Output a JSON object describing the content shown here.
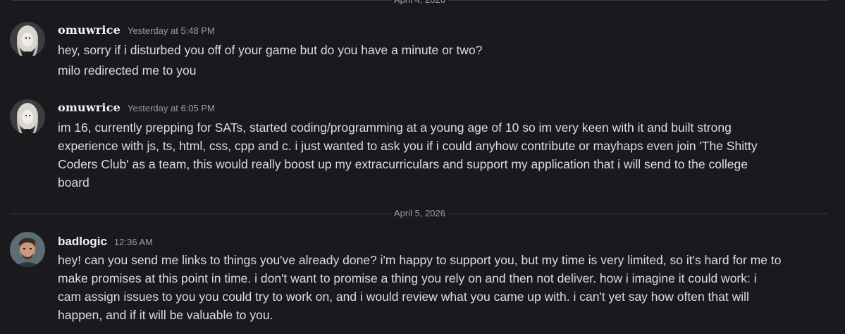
{
  "dividers": {
    "top": "April 4, 2026",
    "middle": "April 5, 2026"
  },
  "messages": [
    {
      "author": "omuwrice",
      "timestamp": "Yesterday at 5:48 PM",
      "lines": [
        "hey, sorry if i disturbed you off of your game but do you have a minute or two?",
        "milo redirected me to you"
      ]
    },
    {
      "author": "omuwrice",
      "timestamp": "Yesterday at 6:05 PM",
      "lines": [
        "im 16, currently prepping for SATs, started coding/programming at a young age of 10 so im very keen with it and built strong",
        "experience with js, ts, html, css, cpp and c. i just wanted to ask you if i could anyhow contribute or mayhaps even join 'The Shitty",
        "Coders Club' as a team, this would really boost up my extracurriculars and support my application that i will send to the college",
        "board"
      ]
    },
    {
      "author": "badlogic",
      "timestamp": "12:36 AM",
      "lines": [
        "hey! can you send me links to things you've already done? i'm happy to support you, but my time is very limited, so it's hard for me to",
        "make promises at this point in time. i don't want to promise a thing you rely on and then not deliver. how i imagine it could work: i",
        "cam assign issues to you you could try to work on, and i would review what you came up with. i can't yet say how often that will",
        "happen, and if it will be valuable to you."
      ]
    }
  ],
  "colors": {
    "background": "#1a1a1e",
    "text": "#dcdde0",
    "muted": "#9a9ca3",
    "divider": "#3a3b41"
  }
}
